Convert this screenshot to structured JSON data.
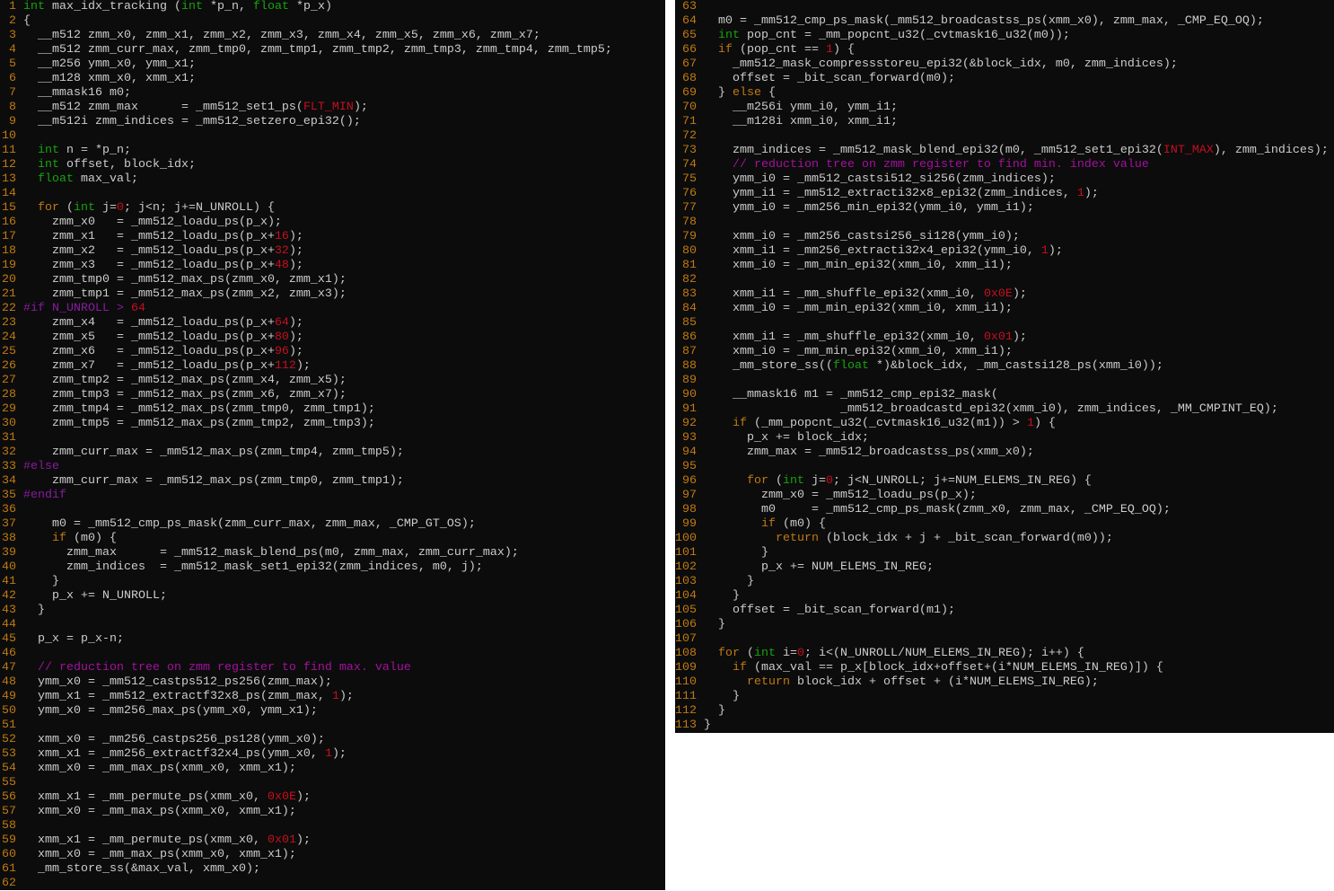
{
  "colors": {
    "background": "#0c0c0c",
    "text": "#cccccc",
    "line_number": "#c07a12",
    "type_keyword": "#16a30e",
    "control_keyword": "#c07a12",
    "number": "#c50f1f",
    "preprocessor": "#8a1aa0",
    "comment": "#a3119e"
  },
  "panels": [
    {
      "id": "left",
      "lines": [
        {
          "n": 1,
          "seg": [
            [
              "t",
              "int"
            ],
            " max_idx_tracking (",
            [
              "t",
              "int"
            ],
            " *p_n, ",
            [
              "t",
              "float"
            ],
            " *p_x)"
          ]
        },
        {
          "n": 2,
          "seg": [
            "{"
          ]
        },
        {
          "n": 3,
          "seg": [
            "  __m512 zmm_x0, zmm_x1, zmm_x2, zmm_x3, zmm_x4, zmm_x5, zmm_x6, zmm_x7;"
          ]
        },
        {
          "n": 4,
          "seg": [
            "  __m512 zmm_curr_max, zmm_tmp0, zmm_tmp1, zmm_tmp2, zmm_tmp3, zmm_tmp4, zmm_tmp5;"
          ]
        },
        {
          "n": 5,
          "seg": [
            "  __m256 ymm_x0, ymm_x1;"
          ]
        },
        {
          "n": 6,
          "seg": [
            "  __m128 xmm_x0, xmm_x1;"
          ]
        },
        {
          "n": 7,
          "seg": [
            "  __mmask16 m0;"
          ]
        },
        {
          "n": 8,
          "seg": [
            "  __m512 zmm_max      = _mm512_set1_ps(",
            [
              "n",
              "FLT_MIN"
            ],
            ");"
          ]
        },
        {
          "n": 9,
          "seg": [
            "  __m512i zmm_indices = _mm512_setzero_epi32();"
          ]
        },
        {
          "n": 10,
          "seg": [
            ""
          ]
        },
        {
          "n": 11,
          "seg": [
            "  ",
            [
              "t",
              "int"
            ],
            " n = *p_n;"
          ]
        },
        {
          "n": 12,
          "seg": [
            "  ",
            [
              "t",
              "int"
            ],
            " offset, block_idx;"
          ]
        },
        {
          "n": 13,
          "seg": [
            "  ",
            [
              "t",
              "float"
            ],
            " max_val;"
          ]
        },
        {
          "n": 14,
          "seg": [
            ""
          ]
        },
        {
          "n": 15,
          "seg": [
            "  ",
            [
              "k",
              "for"
            ],
            " (",
            [
              "t",
              "int"
            ],
            " j=",
            [
              "n",
              "0"
            ],
            "; j<n; j+=N_UNROLL) {"
          ]
        },
        {
          "n": 16,
          "seg": [
            "    zmm_x0   = _mm512_loadu_ps(p_x);"
          ]
        },
        {
          "n": 17,
          "seg": [
            "    zmm_x1   = _mm512_loadu_ps(p_x+",
            [
              "n",
              "16"
            ],
            ");"
          ]
        },
        {
          "n": 18,
          "seg": [
            "    zmm_x2   = _mm512_loadu_ps(p_x+",
            [
              "n",
              "32"
            ],
            ");"
          ]
        },
        {
          "n": 19,
          "seg": [
            "    zmm_x3   = _mm512_loadu_ps(p_x+",
            [
              "n",
              "48"
            ],
            ");"
          ]
        },
        {
          "n": 20,
          "seg": [
            "    zmm_tmp0 = _mm512_max_ps(zmm_x0, zmm_x1);"
          ]
        },
        {
          "n": 21,
          "seg": [
            "    zmm_tmp1 = _mm512_max_ps(zmm_x2, zmm_x3);"
          ]
        },
        {
          "n": 22,
          "seg": [
            [
              "pp",
              "#if N_UNROLL > "
            ],
            [
              "n",
              "64"
            ]
          ]
        },
        {
          "n": 23,
          "seg": [
            "    zmm_x4   = _mm512_loadu_ps(p_x+",
            [
              "n",
              "64"
            ],
            ");"
          ]
        },
        {
          "n": 24,
          "seg": [
            "    zmm_x5   = _mm512_loadu_ps(p_x+",
            [
              "n",
              "80"
            ],
            ");"
          ]
        },
        {
          "n": 25,
          "seg": [
            "    zmm_x6   = _mm512_loadu_ps(p_x+",
            [
              "n",
              "96"
            ],
            ");"
          ]
        },
        {
          "n": 26,
          "seg": [
            "    zmm_x7   = _mm512_loadu_ps(p_x+",
            [
              "n",
              "112"
            ],
            ");"
          ]
        },
        {
          "n": 27,
          "seg": [
            "    zmm_tmp2 = _mm512_max_ps(zmm_x4, zmm_x5);"
          ]
        },
        {
          "n": 28,
          "seg": [
            "    zmm_tmp3 = _mm512_max_ps(zmm_x6, zmm_x7);"
          ]
        },
        {
          "n": 29,
          "seg": [
            "    zmm_tmp4 = _mm512_max_ps(zmm_tmp0, zmm_tmp1);"
          ]
        },
        {
          "n": 30,
          "seg": [
            "    zmm_tmp5 = _mm512_max_ps(zmm_tmp2, zmm_tmp3);"
          ]
        },
        {
          "n": 31,
          "seg": [
            ""
          ]
        },
        {
          "n": 32,
          "seg": [
            "    zmm_curr_max = _mm512_max_ps(zmm_tmp4, zmm_tmp5);"
          ]
        },
        {
          "n": 33,
          "seg": [
            [
              "pp",
              "#else"
            ]
          ]
        },
        {
          "n": 34,
          "seg": [
            "    zmm_curr_max = _mm512_max_ps(zmm_tmp0, zmm_tmp1);"
          ]
        },
        {
          "n": 35,
          "seg": [
            [
              "pp",
              "#endif"
            ]
          ]
        },
        {
          "n": 36,
          "seg": [
            ""
          ]
        },
        {
          "n": 37,
          "seg": [
            "    m0 = _mm512_cmp_ps_mask(zmm_curr_max, zmm_max, _CMP_GT_OS);"
          ]
        },
        {
          "n": 38,
          "seg": [
            "    ",
            [
              "k",
              "if"
            ],
            " (m0) {"
          ]
        },
        {
          "n": 39,
          "seg": [
            "      zmm_max      = _mm512_mask_blend_ps(m0, zmm_max, zmm_curr_max);"
          ]
        },
        {
          "n": 40,
          "seg": [
            "      zmm_indices  = _mm512_mask_set1_epi32(zmm_indices, m0, j);"
          ]
        },
        {
          "n": 41,
          "seg": [
            "    }"
          ]
        },
        {
          "n": 42,
          "seg": [
            "    p_x += N_UNROLL;"
          ]
        },
        {
          "n": 43,
          "seg": [
            "  }"
          ]
        },
        {
          "n": 44,
          "seg": [
            ""
          ]
        },
        {
          "n": 45,
          "seg": [
            "  p_x = p_x-n;"
          ]
        },
        {
          "n": 46,
          "seg": [
            ""
          ]
        },
        {
          "n": 47,
          "seg": [
            "  ",
            [
              "c",
              "// reduction tree on zmm register to find max. value"
            ]
          ]
        },
        {
          "n": 48,
          "seg": [
            "  ymm_x0 = _mm512_castps512_ps256(zmm_max);"
          ]
        },
        {
          "n": 49,
          "seg": [
            "  ymm_x1 = _mm512_extractf32x8_ps(zmm_max, ",
            [
              "n",
              "1"
            ],
            ");"
          ]
        },
        {
          "n": 50,
          "seg": [
            "  ymm_x0 = _mm256_max_ps(ymm_x0, ymm_x1);"
          ]
        },
        {
          "n": 51,
          "seg": [
            ""
          ]
        },
        {
          "n": 52,
          "seg": [
            "  xmm_x0 = _mm256_castps256_ps128(ymm_x0);"
          ]
        },
        {
          "n": 53,
          "seg": [
            "  xmm_x1 = _mm256_extractf32x4_ps(ymm_x0, ",
            [
              "n",
              "1"
            ],
            ");"
          ]
        },
        {
          "n": 54,
          "seg": [
            "  xmm_x0 = _mm_max_ps(xmm_x0, xmm_x1);"
          ]
        },
        {
          "n": 55,
          "seg": [
            ""
          ]
        },
        {
          "n": 56,
          "seg": [
            "  xmm_x1 = _mm_permute_ps(xmm_x0, ",
            [
              "n",
              "0x0E"
            ],
            ");"
          ]
        },
        {
          "n": 57,
          "seg": [
            "  xmm_x0 = _mm_max_ps(xmm_x0, xmm_x1);"
          ]
        },
        {
          "n": 58,
          "seg": [
            ""
          ]
        },
        {
          "n": 59,
          "seg": [
            "  xmm_x1 = _mm_permute_ps(xmm_x0, ",
            [
              "n",
              "0x01"
            ],
            ");"
          ]
        },
        {
          "n": 60,
          "seg": [
            "  xmm_x0 = _mm_max_ps(xmm_x0, xmm_x1);"
          ]
        },
        {
          "n": 61,
          "seg": [
            "  _mm_store_ss(&max_val, xmm_x0);"
          ]
        },
        {
          "n": 62,
          "seg": [
            ""
          ]
        }
      ]
    },
    {
      "id": "right",
      "lines": [
        {
          "n": 63,
          "seg": [
            ""
          ]
        },
        {
          "n": 64,
          "seg": [
            "  m0 = _mm512_cmp_ps_mask(_mm512_broadcastss_ps(xmm_x0), zmm_max, _CMP_EQ_OQ);"
          ]
        },
        {
          "n": 65,
          "seg": [
            "  ",
            [
              "t",
              "int"
            ],
            " pop_cnt = _mm_popcnt_u32(_cvtmask16_u32(m0));"
          ]
        },
        {
          "n": 66,
          "seg": [
            "  ",
            [
              "k",
              "if"
            ],
            " (pop_cnt == ",
            [
              "n",
              "1"
            ],
            ") {"
          ]
        },
        {
          "n": 67,
          "seg": [
            "    _mm512_mask_compressstoreu_epi32(&block_idx, m0, zmm_indices);"
          ]
        },
        {
          "n": 68,
          "seg": [
            "    offset = _bit_scan_forward(m0);"
          ]
        },
        {
          "n": 69,
          "seg": [
            "  } ",
            [
              "k",
              "else"
            ],
            " {"
          ]
        },
        {
          "n": 70,
          "seg": [
            "    __m256i ymm_i0, ymm_i1;"
          ]
        },
        {
          "n": 71,
          "seg": [
            "    __m128i xmm_i0, xmm_i1;"
          ]
        },
        {
          "n": 72,
          "seg": [
            ""
          ]
        },
        {
          "n": 73,
          "seg": [
            "    zmm_indices = _mm512_mask_blend_epi32(m0, _mm512_set1_epi32(",
            [
              "n",
              "INT_MAX"
            ],
            "), zmm_indices);"
          ]
        },
        {
          "n": 74,
          "seg": [
            "    ",
            [
              "c",
              "// reduction tree on zmm register to find min. index value"
            ]
          ]
        },
        {
          "n": 75,
          "seg": [
            "    ymm_i0 = _mm512_castsi512_si256(zmm_indices);"
          ]
        },
        {
          "n": 76,
          "seg": [
            "    ymm_i1 = _mm512_extracti32x8_epi32(zmm_indices, ",
            [
              "n",
              "1"
            ],
            ");"
          ]
        },
        {
          "n": 77,
          "seg": [
            "    ymm_i0 = _mm256_min_epi32(ymm_i0, ymm_i1);"
          ]
        },
        {
          "n": 78,
          "seg": [
            ""
          ]
        },
        {
          "n": 79,
          "seg": [
            "    xmm_i0 = _mm256_castsi256_si128(ymm_i0);"
          ]
        },
        {
          "n": 80,
          "seg": [
            "    xmm_i1 = _mm256_extracti32x4_epi32(ymm_i0, ",
            [
              "n",
              "1"
            ],
            ");"
          ]
        },
        {
          "n": 81,
          "seg": [
            "    xmm_i0 = _mm_min_epi32(xmm_i0, xmm_i1);"
          ]
        },
        {
          "n": 82,
          "seg": [
            ""
          ]
        },
        {
          "n": 83,
          "seg": [
            "    xmm_i1 = _mm_shuffle_epi32(xmm_i0, ",
            [
              "n",
              "0x0E"
            ],
            ");"
          ]
        },
        {
          "n": 84,
          "seg": [
            "    xmm_i0 = _mm_min_epi32(xmm_i0, xmm_i1);"
          ]
        },
        {
          "n": 85,
          "seg": [
            ""
          ]
        },
        {
          "n": 86,
          "seg": [
            "    xmm_i1 = _mm_shuffle_epi32(xmm_i0, ",
            [
              "n",
              "0x01"
            ],
            ");"
          ]
        },
        {
          "n": 87,
          "seg": [
            "    xmm_i0 = _mm_min_epi32(xmm_i0, xmm_i1);"
          ]
        },
        {
          "n": 88,
          "seg": [
            "    _mm_store_ss((",
            [
              "t",
              "float"
            ],
            " *)&block_idx, _mm_castsi128_ps(xmm_i0));"
          ]
        },
        {
          "n": 89,
          "seg": [
            ""
          ]
        },
        {
          "n": 90,
          "seg": [
            "    __mmask16 m1 = _mm512_cmp_epi32_mask("
          ]
        },
        {
          "n": 91,
          "seg": [
            "                   _mm512_broadcastd_epi32(xmm_i0), zmm_indices, _MM_CMPINT_EQ);"
          ]
        },
        {
          "n": 92,
          "seg": [
            "    ",
            [
              "k",
              "if"
            ],
            " (_mm_popcnt_u32(_cvtmask16_u32(m1)) > ",
            [
              "n",
              "1"
            ],
            ") {"
          ]
        },
        {
          "n": 93,
          "seg": [
            "      p_x += block_idx;"
          ]
        },
        {
          "n": 94,
          "seg": [
            "      zmm_max = _mm512_broadcastss_ps(xmm_x0);"
          ]
        },
        {
          "n": 95,
          "seg": [
            ""
          ]
        },
        {
          "n": 96,
          "seg": [
            "      ",
            [
              "k",
              "for"
            ],
            " (",
            [
              "t",
              "int"
            ],
            " j=",
            [
              "n",
              "0"
            ],
            "; j<N_UNROLL; j+=NUM_ELEMS_IN_REG) {"
          ]
        },
        {
          "n": 97,
          "seg": [
            "        zmm_x0 = _mm512_loadu_ps(p_x);"
          ]
        },
        {
          "n": 98,
          "seg": [
            "        m0     = _mm512_cmp_ps_mask(zmm_x0, zmm_max, _CMP_EQ_OQ);"
          ]
        },
        {
          "n": 99,
          "seg": [
            "        ",
            [
              "k",
              "if"
            ],
            " (m0) {"
          ]
        },
        {
          "n": 100,
          "seg": [
            "          ",
            [
              "k",
              "return"
            ],
            " (block_idx + j + _bit_scan_forward(m0));"
          ]
        },
        {
          "n": 101,
          "seg": [
            "        }"
          ]
        },
        {
          "n": 102,
          "seg": [
            "        p_x += NUM_ELEMS_IN_REG;"
          ]
        },
        {
          "n": 103,
          "seg": [
            "      }"
          ]
        },
        {
          "n": 104,
          "seg": [
            "    }"
          ]
        },
        {
          "n": 105,
          "seg": [
            "    offset = _bit_scan_forward(m1);"
          ]
        },
        {
          "n": 106,
          "seg": [
            "  }"
          ]
        },
        {
          "n": 107,
          "seg": [
            ""
          ]
        },
        {
          "n": 108,
          "seg": [
            "  ",
            [
              "k",
              "for"
            ],
            " (",
            [
              "t",
              "int"
            ],
            " i=",
            [
              "n",
              "0"
            ],
            "; i<(N_UNROLL/NUM_ELEMS_IN_REG); i++) {"
          ]
        },
        {
          "n": 109,
          "seg": [
            "    ",
            [
              "k",
              "if"
            ],
            " (max_val == p_x[block_idx+offset+(i*NUM_ELEMS_IN_REG)]) {"
          ]
        },
        {
          "n": 110,
          "seg": [
            "      ",
            [
              "k",
              "return"
            ],
            " block_idx + offset + (i*NUM_ELEMS_IN_REG);"
          ]
        },
        {
          "n": 111,
          "seg": [
            "    }"
          ]
        },
        {
          "n": 112,
          "seg": [
            "  }"
          ]
        },
        {
          "n": 113,
          "seg": [
            "}"
          ]
        }
      ]
    }
  ]
}
